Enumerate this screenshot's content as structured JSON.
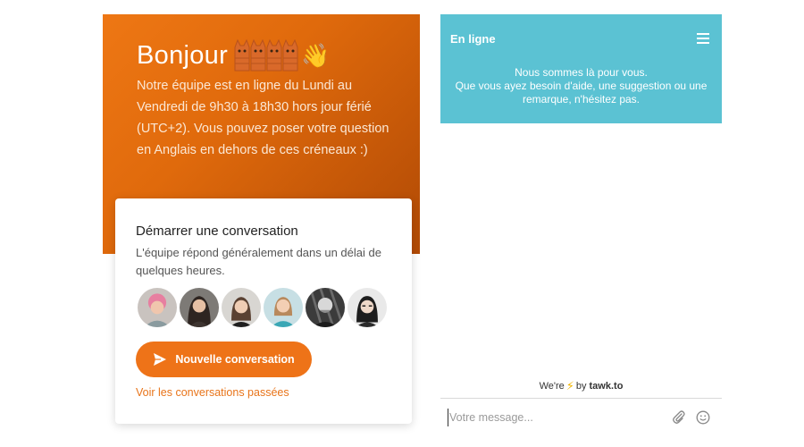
{
  "left_widget": {
    "greeting": "Bonjour",
    "greeting_emoji": "👋",
    "intro": "Notre équipe est en ligne du Lundi au Vendredi de 9h30 à 18h30 hors jour férié (UTC+2). Vous pouvez poser votre question en Anglais en dehors de ces créneaux :)",
    "card": {
      "title": "Démarrer une conversation",
      "subtitle": "L'équipe répond généralement dans un délai de quelques heures.",
      "new_conversation_label": "Nouvelle conversation",
      "past_conversations_label": "Voir les conversations passées"
    },
    "colors": {
      "accent": "#ee7318",
      "hero_start": "#ee7714",
      "hero_end": "#b14a05"
    }
  },
  "right_widget": {
    "status": "En ligne",
    "header_message_line1": "Nous sommes là pour vous.",
    "header_message_line2": "Que vous ayez besoin d'aide, une suggestion ou une remarque, n'hésitez pas.",
    "powered_prefix": "We're",
    "powered_mid": "by",
    "powered_brand": "tawk.to",
    "input_placeholder": "Votre message...",
    "colors": {
      "header": "#5bc2d3"
    }
  }
}
